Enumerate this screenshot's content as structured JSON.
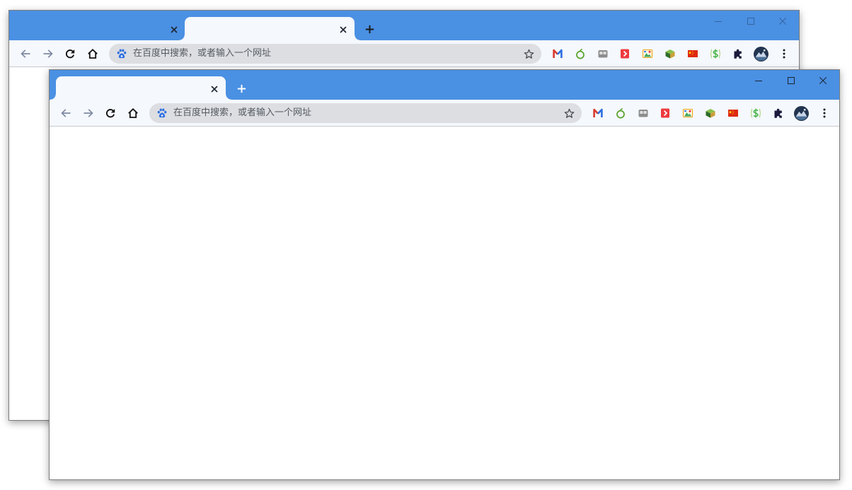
{
  "windows": [
    {
      "name": "background-browser-window",
      "tabs": [
        {
          "active": false,
          "close_icon": "close-icon"
        },
        {
          "active": true,
          "close_icon": "close-icon"
        }
      ],
      "new_tab_icon": "plus-icon",
      "window_controls": [
        "minimize-icon",
        "maximize-icon",
        "close-icon"
      ],
      "nav_icons": [
        "back-arrow-icon",
        "forward-arrow-icon",
        "reload-icon",
        "home-icon"
      ],
      "omnibox": {
        "engine_icon": "baidu-paw-icon",
        "placeholder": "在百度中搜索，或者输入一个网址",
        "bookmark_icon": "star-outline-icon"
      },
      "extension_icons": [
        "m-logo-extension-icon",
        "green-apple-extension-icon",
        "gray-tiles-extension-icon",
        "red-arrow-extension-icon",
        "image-extension-icon",
        "cube-extension-icon",
        "china-flag-extension-icon",
        "green-dollar-extension-icon"
      ],
      "extensions_menu_icon": "puzzle-icon",
      "profile_icon": "profile-avatar",
      "menu_icon": "more-vertical-icon"
    },
    {
      "name": "foreground-browser-window",
      "tabs": [
        {
          "active": true,
          "close_icon": "close-icon"
        }
      ],
      "new_tab_icon": "plus-icon",
      "window_controls": [
        "minimize-icon",
        "maximize-icon",
        "close-icon"
      ],
      "nav_icons": [
        "back-arrow-icon",
        "forward-arrow-icon",
        "reload-icon",
        "home-icon"
      ],
      "omnibox": {
        "engine_icon": "baidu-paw-icon",
        "placeholder": "在百度中搜索，或者输入一个网址",
        "bookmark_icon": "star-outline-icon"
      },
      "extension_icons": [
        "m-logo-extension-icon",
        "green-apple-extension-icon",
        "gray-tiles-extension-icon",
        "red-arrow-extension-icon",
        "image-extension-icon",
        "cube-extension-icon",
        "china-flag-extension-icon",
        "green-dollar-extension-icon"
      ],
      "extensions_menu_icon": "puzzle-icon",
      "profile_icon": "profile-avatar",
      "menu_icon": "more-vertical-icon"
    }
  ],
  "colors": {
    "title_bar": "#4a90e3",
    "active_tab": "#f5f8fc",
    "toolbar": "#f5f8fc",
    "omnibox": "#dcdee2",
    "content": "#ffffff"
  }
}
